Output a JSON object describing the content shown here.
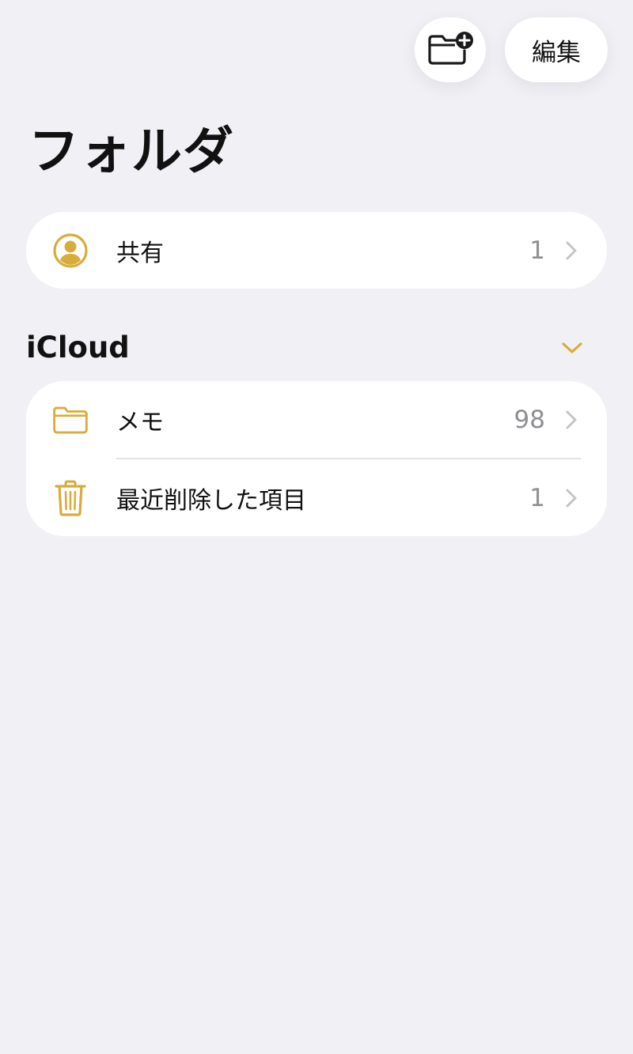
{
  "toolbar": {
    "new_folder_icon": "folder-badge-plus-icon",
    "edit_label": "編集"
  },
  "page": {
    "title": "フォルダ"
  },
  "shared": {
    "icon": "person-circle-icon",
    "label": "共有",
    "count": "1"
  },
  "icloud": {
    "title": "iCloud",
    "toggle_icon": "chevron-down-icon",
    "items": [
      {
        "icon": "folder-icon",
        "label": "メモ",
        "count": "98"
      },
      {
        "icon": "trash-icon",
        "label": "最近削除した項目",
        "count": "1"
      }
    ]
  },
  "colors": {
    "accent": "#d8ac3c",
    "background": "#f1f0f5",
    "card": "#ffffff",
    "secondary_text": "#8e8e93",
    "chevron": "#c4c4c8"
  }
}
